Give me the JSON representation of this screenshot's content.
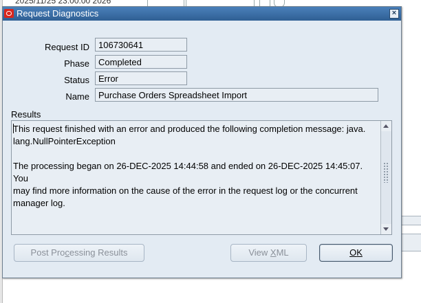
{
  "background": {
    "datetime_fragment": "2025/11/25 23:00:00  2026"
  },
  "dialog": {
    "title": "Request Diagnostics",
    "close_label": "×",
    "fields": {
      "request_id_label": "Request ID",
      "request_id": "106730641",
      "phase_label": "Phase",
      "phase": "Completed",
      "status_label": "Status",
      "status": "Error",
      "name_label": "Name",
      "name": "Purchase Orders Spreadsheet Import"
    },
    "results_label": "Results",
    "results_text": "This request finished with an error and produced the following completion message: java.\nlang.NullPointerException\n\nThe processing began on 26-DEC-2025 14:44:58 and ended on 26-DEC-2025 14:45:07. You\nmay find more information on the cause of the error in the request log or the concurrent\nmanager log.",
    "buttons": {
      "post_processing": {
        "before": "Post Pro",
        "mnemonic": "c",
        "after": "essing Results"
      },
      "view_xml": {
        "before": "View ",
        "mnemonic": "X",
        "after": "ML"
      },
      "ok": {
        "before": "",
        "mnemonic": "O",
        "after": "K"
      }
    }
  }
}
